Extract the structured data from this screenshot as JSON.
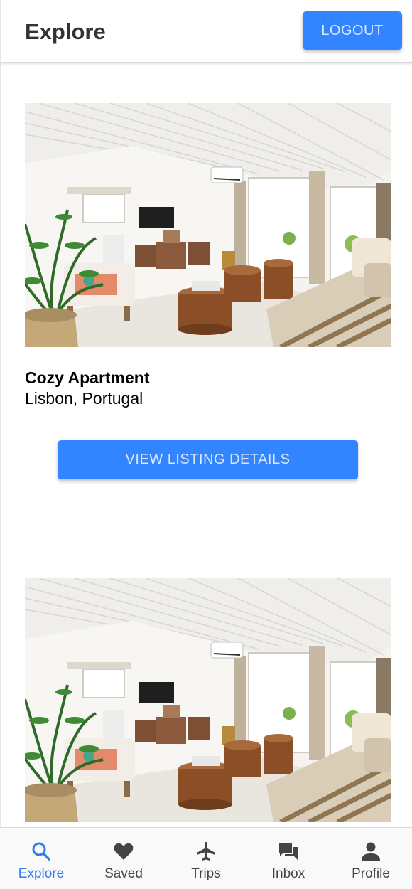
{
  "header": {
    "title": "Explore",
    "logout_label": "LOGOUT"
  },
  "listings": [
    {
      "name": "Cozy Apartment",
      "location": "Lisbon, Portugal",
      "button_label": "VIEW LISTING DETAILS"
    }
  ],
  "bottom_nav": {
    "items": [
      {
        "label": "Explore",
        "icon": "search-icon",
        "active": true
      },
      {
        "label": "Saved",
        "icon": "heart-icon",
        "active": false
      },
      {
        "label": "Trips",
        "icon": "airplane-icon",
        "active": false
      },
      {
        "label": "Inbox",
        "icon": "chat-icon",
        "active": false
      },
      {
        "label": "Profile",
        "icon": "person-icon",
        "active": false
      }
    ]
  },
  "colors": {
    "accent": "#3385ff",
    "active_nav": "#2f7ef6",
    "inactive_nav": "#444444"
  }
}
